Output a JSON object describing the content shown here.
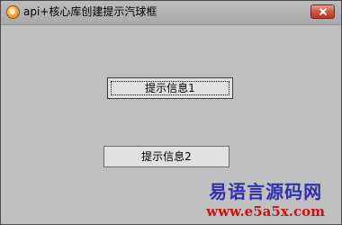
{
  "window": {
    "title": "api+核心库创建提示汽球框",
    "app_icon": "app-orb-icon",
    "close_icon": "close-icon"
  },
  "buttons": [
    {
      "label": "提示信息1",
      "focused": true
    },
    {
      "label": "提示信息2",
      "focused": false
    }
  ],
  "watermark": {
    "line1": "易语言源码网",
    "line2": "www.e5a5x.com"
  },
  "colors": {
    "client_bg": "#c0c0c0",
    "button_bg": "#e1e1e1",
    "close_button": "#c94a36",
    "watermark_blue": "#2f2fb0",
    "watermark_red": "#d01010"
  }
}
